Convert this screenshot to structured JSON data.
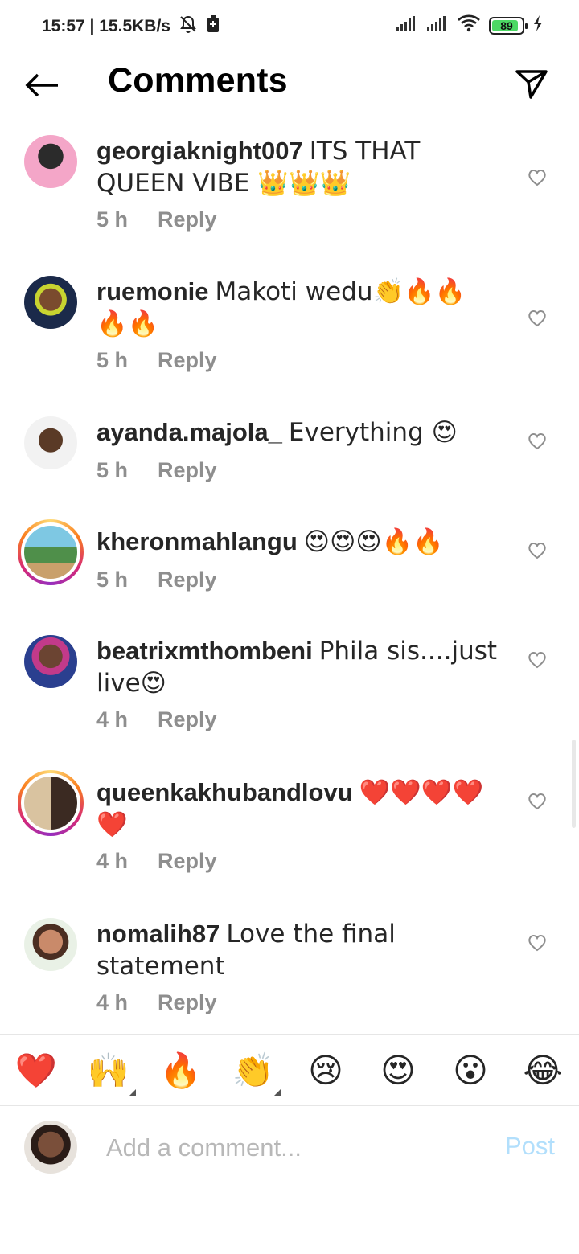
{
  "status_bar": {
    "time_speed": "15:57 | 15.5KB/s",
    "battery_level": "89",
    "battery_color": "#4cd964",
    "icons": [
      "muted-bell-icon",
      "battery-saver-icon",
      "signal-icon",
      "signal-icon",
      "wifi-icon",
      "battery-icon",
      "charging-icon"
    ]
  },
  "header": {
    "title": "Comments",
    "back_icon": "arrow-left-icon",
    "share_icon": "paper-plane-icon"
  },
  "comments": [
    {
      "username": "georgiaknight007",
      "text": "ITS THAT QUEEN VIBE 👑👑👑",
      "time": "5 h",
      "reply": "Reply",
      "story_ring": false
    },
    {
      "username": "ruemonie",
      "text": "Makoti wedu👏🔥🔥🔥🔥",
      "time": "5 h",
      "reply": "Reply",
      "story_ring": false
    },
    {
      "username": "ayanda.majola_",
      "text": "Everything 😍",
      "time": "5 h",
      "reply": "Reply",
      "story_ring": false
    },
    {
      "username": "kheronmahlangu",
      "text": "😍😍😍🔥🔥",
      "time": "5 h",
      "reply": "Reply",
      "story_ring": true
    },
    {
      "username": "beatrixmthombeni",
      "text": "Phila sis....just live😍",
      "time": "4 h",
      "reply": "Reply",
      "story_ring": false
    },
    {
      "username": "queenkakhubandlovu",
      "text": "❤️❤️❤️❤️❤️",
      "time": "4 h",
      "reply": "Reply",
      "story_ring": true
    },
    {
      "username": "nomalih87",
      "text": "Love the final statement",
      "time": "4 h",
      "reply": "Reply",
      "story_ring": false
    }
  ],
  "reactions": [
    "❤️",
    "🙌",
    "🔥",
    "👏",
    "😢",
    "😍",
    "😮",
    "😂"
  ],
  "composer": {
    "placeholder": "Add a comment...",
    "post_label": "Post",
    "post_color": "#b2dffc"
  },
  "colors": {
    "text_primary": "#262626",
    "text_secondary": "#8e8e8e",
    "story_ring": [
      "#feda75",
      "#fa7e1e",
      "#d62976",
      "#962fbf"
    ]
  }
}
